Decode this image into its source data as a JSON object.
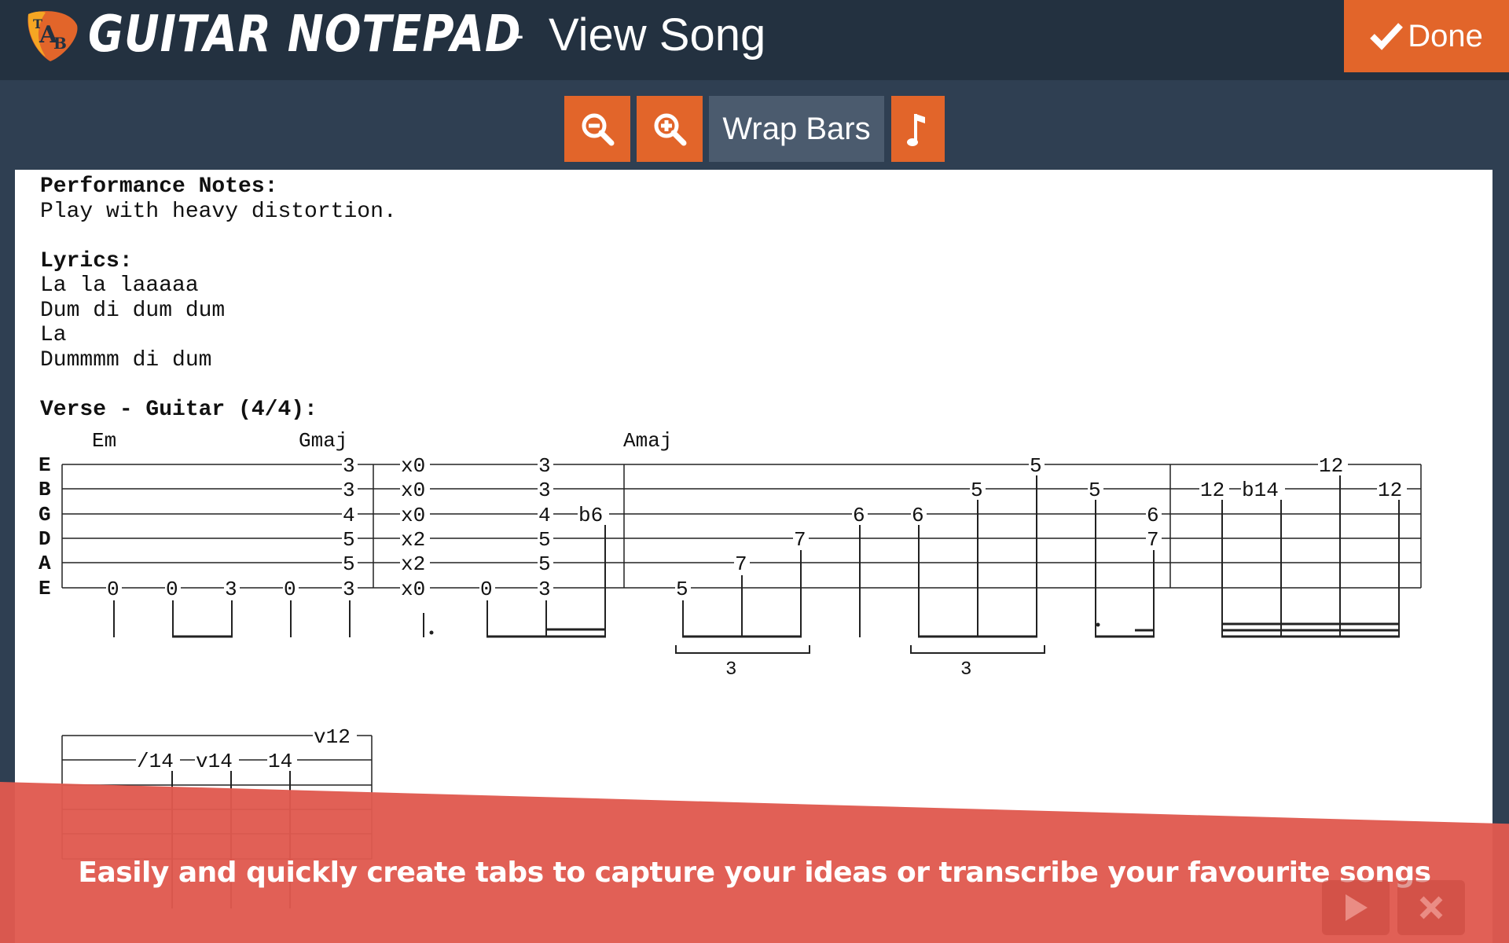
{
  "header": {
    "app_name": "GUITAR NOTEPAD",
    "separator": "-",
    "page_title": "View Song",
    "done_label": "Done",
    "logo_icon": "tab-pick-logo-icon",
    "done_icon": "checkmark-icon"
  },
  "toolbar": {
    "zoom_out_icon": "zoom-out-icon",
    "zoom_in_icon": "zoom-in-icon",
    "wrap_label": "Wrap Bars",
    "note_icon": "eighth-note-icon"
  },
  "song": {
    "perf_heading": "Performance Notes:",
    "perf_text": "Play with heavy distortion.",
    "lyrics_heading": "Lyrics:",
    "lyrics": [
      "La la laaaaa",
      "Dum di dum dum",
      "La",
      "Dummmm di dum"
    ],
    "section_heading": "Verse - Guitar (4/4):",
    "string_names": [
      "E",
      "B",
      "G",
      "D",
      "A",
      "E"
    ],
    "chords": [
      "Em",
      "Gmaj",
      "Amaj"
    ],
    "tab_numbers": {
      "bar1": [
        "0",
        "0",
        "3",
        "0",
        "3",
        "3",
        "4",
        "5",
        "5",
        "3"
      ],
      "bar2": [
        "x0",
        "x0",
        "x0",
        "x2",
        "x2",
        "x0",
        "0",
        "3",
        "3",
        "4",
        "5",
        "5",
        "3",
        "b6"
      ],
      "bar3": [
        "5",
        "7",
        "7",
        "6",
        "6",
        "5",
        "5",
        "5",
        "6",
        "7"
      ],
      "bar4": [
        "12",
        "12",
        "b14",
        "12"
      ],
      "bar5": [
        "v12",
        "/14",
        "v14",
        "14"
      ],
      "tuplets": [
        "3",
        "3"
      ]
    }
  },
  "colors": {
    "header_bg": "#233140",
    "page_bg": "#2f3f52",
    "accent": "#e2652a",
    "banner": "#e05a4f"
  },
  "banner": {
    "text": "Easily and quickly create tabs to capture your ideas or transcribe your favourite songs",
    "play_icon": "play-icon",
    "close_icon": "close-icon"
  }
}
